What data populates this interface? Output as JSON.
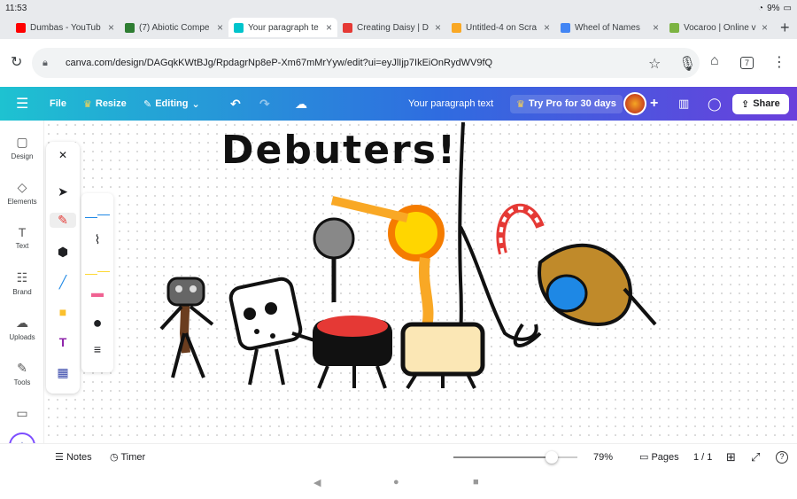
{
  "status": {
    "time": "11:53",
    "battery": "9%"
  },
  "tabs": [
    {
      "label": "Dumbas - YouTub",
      "color": "#ff0000"
    },
    {
      "label": "(7) Abiotic Compe",
      "color": "#2e7d32"
    },
    {
      "label": "Your paragraph te",
      "color": "#00c4cc",
      "active": true
    },
    {
      "label": "Creating Daisy | D",
      "color": "#e53935"
    },
    {
      "label": "Untitled-4 on Scra",
      "color": "#f9a825"
    },
    {
      "label": "Wheel of Names",
      "color": "#4285f4"
    },
    {
      "label": "Vocaroo | Online v",
      "color": "#7cb342"
    }
  ],
  "url": "canva.com/design/DAGqkKWtBJg/RpdagrNp8eP-Xm67mMrYyw/edit?ui=eyJlIjp7IkEiOnRydWV9fQ",
  "tab_count": "7",
  "canva": {
    "file": "File",
    "resize": "Resize",
    "editing": "Editing",
    "doc_title": "Your paragraph text",
    "try_pro": "Try Pro for 30 days",
    "share": "Share"
  },
  "sidebar": [
    {
      "label": "Design",
      "icon": "design-icon"
    },
    {
      "label": "Elements",
      "icon": "elements-icon"
    },
    {
      "label": "Text",
      "icon": "text-icon"
    },
    {
      "label": "Brand",
      "icon": "brand-icon"
    },
    {
      "label": "Uploads",
      "icon": "uploads-icon"
    },
    {
      "label": "Tools",
      "icon": "tools-icon"
    }
  ],
  "drawing_title": "Debuters!",
  "bottom": {
    "notes": "Notes",
    "timer": "Timer",
    "zoom": "79%",
    "zoom_level": 0.79,
    "pages": "Pages",
    "page_count": "1 / 1"
  }
}
